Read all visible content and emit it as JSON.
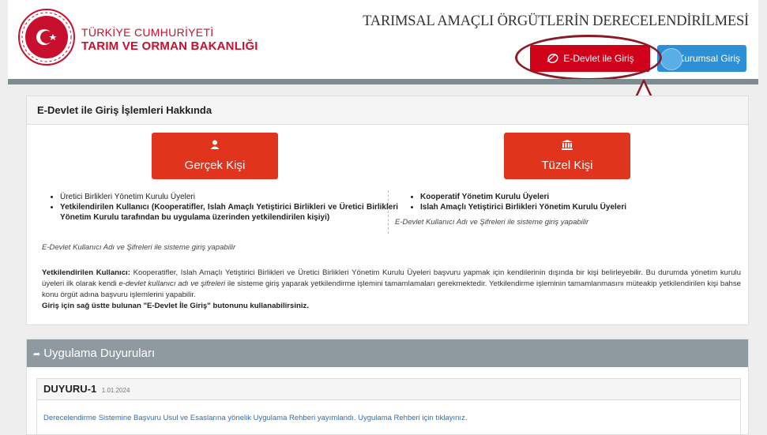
{
  "header": {
    "ministry_line1": "TÜRKİYE CUMHURİYETİ",
    "ministry_line2": "TARIM VE ORMAN BAKANLIĞI",
    "system_title": "TARIMSAL AMAÇLI ÖRGÜTLERİN DERECELENDİRİLMESİ",
    "edevlet_button": "E-Devlet ile Giriş",
    "kurumsal_button": "Kurumsal Giriş"
  },
  "info": {
    "title": "E-Devlet ile Giriş İşlemleri Hakkında",
    "gercek_button": "Gerçek Kişi",
    "tuzel_button": "Tüzel Kişi",
    "left_items": [
      "Üretici Birlikleri Yönetim Kurulu Üyeleri",
      "Yetkilendirilen Kullanıcı (Kooperatifler, Islah Amaçlı Yetiştirici Birlikleri ve Üretici Birlikleri Yönetim Kurulu tarafından bu uygulama üzerinden yetkilendirilen kişiyi)"
    ],
    "left_note": "E-Devlet Kullanıcı Adı ve Şifreleri ile sisteme giriş yapabilir",
    "right_items": [
      "Kooperatif Yönetim Kurulu Üyeleri",
      "Islah Amaçlı Yetiştirici Birlikleri Yönetim Kurulu Üyeleri"
    ],
    "right_note": "E-Devlet Kullanıcı Adı ve Şifreleri ile sisteme giriş yapabilir",
    "para_label": "Yetkilendirilen Kullanıcı:",
    "para_text1": "Kooperatifler, Islah Amaçlı Yetiştirici Birlikleri ve Üretici Birlikleri Yönetim Kurulu Üyeleri başvuru yapmak için kendilerinin dışında bir kişi belirleyebilir. Bu durumda yönetim kurulu üyeleri ilk olarak kendi",
    "para_italic": "e-devlet kullanıcı adı ve şifreleri",
    "para_text2": "ile sisteme giriş yaparak yetkilendirme işlemini tamamlamaları gerekmektedir. Yetkilendirme işleminin tamamlanmasını müteakip yetkilendirilen kişi bahse konu örgüt adına başvuru işlemlerini yapabilir.",
    "para_bold_line": "Giriş için sağ üstte bulunan \"E-Devlet İle Giriş\" butonunu kullanabilirsiniz."
  },
  "announcements": {
    "title": "Uygulama Duyuruları",
    "item_title": "DUYURU-1",
    "item_date": "1.01.2024",
    "item_text": "Derecelendirme Sistemine Başvuru Usul ve Esaslarına yönelik Uygulama Rehberi yayımlandı. Uygulama Rehberi için tıklayınız."
  }
}
